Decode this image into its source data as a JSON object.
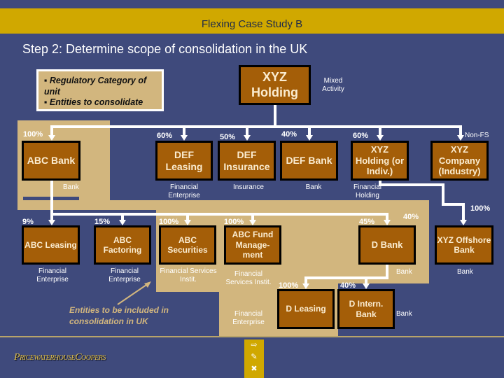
{
  "header": {
    "title": "Flexing Case Study B"
  },
  "step_title": "Step 2: Determine scope of consolidation in the UK",
  "legend": {
    "items": [
      "Regulatory Category of unit",
      "Entities to consolidate"
    ]
  },
  "note": "Entities to be included in consolidation in UK",
  "logo": "PricewaterhouseCoopers",
  "colors": {
    "background": "#3f4a7c",
    "header": "#d0a800",
    "entity_box": "#a45e08",
    "scope_area": "#d2b67e"
  },
  "entities": {
    "xyz_holding": {
      "name": "XYZ Holding",
      "category": "Mixed Activity"
    },
    "abc_bank": {
      "name": "ABC Bank",
      "pct": "100%",
      "category": "Bank"
    },
    "def_leasing": {
      "name": "DEF Leasing",
      "pct": "60%",
      "category": "Financial Enterprise"
    },
    "def_insurance": {
      "name": "DEF Insurance",
      "pct": "50%",
      "category": "Insurance"
    },
    "def_bank": {
      "name": "DEF Bank",
      "pct": "40%",
      "category": "Bank"
    },
    "xyz_holding_indiv": {
      "name": "XYZ Holding (or Indiv.)",
      "pct": "60%",
      "category": "Financial Holding"
    },
    "xyz_company": {
      "name": "XYZ Company (Industry)",
      "pct": "Non-FS"
    },
    "abc_leasing": {
      "name": "ABC Leasing",
      "pct": "9%",
      "category": "Financial Enterprise"
    },
    "abc_factoring": {
      "name": "ABC Factoring",
      "pct": "15%",
      "category": "Financial Enterprise"
    },
    "abc_securities": {
      "name": "ABC Securities",
      "pct": "100%",
      "category": "Financial Services Instit."
    },
    "abc_fund": {
      "name": "ABC Fund Manage-ment",
      "pct": "100%",
      "category": "Financial Services Instit."
    },
    "d_bank": {
      "name": "D Bank",
      "pct": "45%",
      "pct2": "40%",
      "category": "Bank"
    },
    "xyz_offshore": {
      "name": "XYZ Offshore Bank",
      "pct": "100%",
      "category": "Bank"
    },
    "d_leasing": {
      "name": "D Leasing",
      "pct": "100%",
      "category": "Financial Enterprise"
    },
    "d_intern": {
      "name": "D Intern. Bank",
      "pct": "40%",
      "category": "Bank"
    }
  },
  "nav_icons": [
    "exit-icon",
    "pen-icon",
    "close-icon"
  ]
}
